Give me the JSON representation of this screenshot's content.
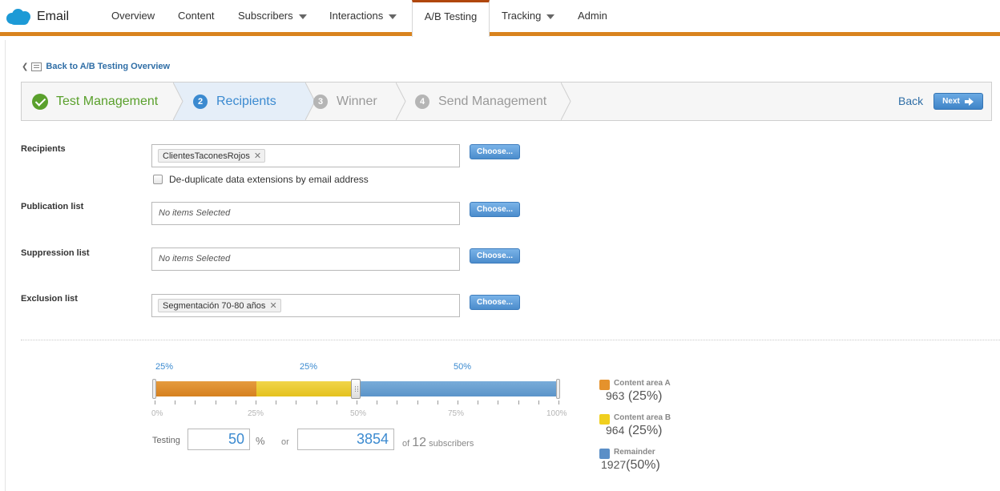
{
  "app": {
    "title": "Email"
  },
  "nav": {
    "items": [
      {
        "label": "Overview"
      },
      {
        "label": "Content"
      },
      {
        "label": "Subscribers"
      },
      {
        "label": "Interactions"
      },
      {
        "label": "A/B Testing"
      },
      {
        "label": "Tracking"
      },
      {
        "label": "Admin"
      }
    ],
    "active": "A/B Testing"
  },
  "back_link": "Back to A/B Testing Overview",
  "wizard": {
    "steps": [
      {
        "number": "",
        "label": "Test Management",
        "state": "complete"
      },
      {
        "number": "2",
        "label": "Recipients",
        "state": "active"
      },
      {
        "number": "3",
        "label": "Winner",
        "state": "pending"
      },
      {
        "number": "4",
        "label": "Send Management",
        "state": "pending"
      }
    ],
    "back_label": "Back",
    "next_label": "Next"
  },
  "form": {
    "recipients": {
      "label": "Recipients",
      "tag": "ClientesTaconesRojos",
      "button": "Choose..."
    },
    "dedupe": {
      "label": "De-duplicate data extensions by email address",
      "checked": false
    },
    "publication": {
      "label": "Publication list",
      "placeholder": "No items Selected",
      "button": "Choose..."
    },
    "suppression": {
      "label": "Suppression list",
      "placeholder": "No items Selected",
      "button": "Choose..."
    },
    "exclusion": {
      "label": "Exclusion list",
      "tag": "Segmentación 70-80 años",
      "button": "Choose..."
    }
  },
  "split": {
    "segment_percents": [
      "25%",
      "25%",
      "50%"
    ],
    "scale_labels": [
      "0%",
      "25%",
      "50%",
      "75%",
      "100%"
    ],
    "testing_label": "Testing",
    "testing_percent": "50",
    "percent_sign": "%",
    "or_label": "or",
    "testing_count": "3854",
    "of_label": "of",
    "of_count": "12",
    "subscribers_label": "subscribers",
    "legend": [
      {
        "name": "Content area A",
        "count": "963",
        "percent": "(25%)",
        "color": "#e5922c"
      },
      {
        "name": "Content area B",
        "count": "964",
        "percent": "(25%)",
        "color": "#f0cf1e"
      },
      {
        "name": "Remainder",
        "count": "1927",
        "percent": "(50%)",
        "color": "#5b8fc7"
      }
    ]
  },
  "colors": {
    "accent": "#d9831d",
    "active_tab": "#b0470d",
    "link": "#2f6ea6",
    "primary_button": "#4b8ccc"
  }
}
